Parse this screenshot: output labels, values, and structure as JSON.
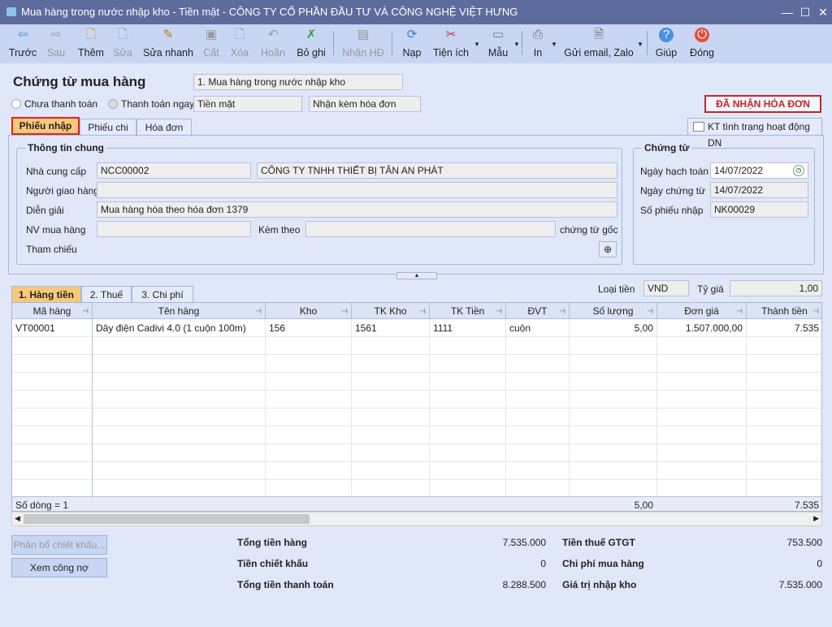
{
  "window": {
    "title": "Mua hàng trong nước nhập kho - Tiền mặt - CÔNG TY CỔ PHẦN ĐẦU TƯ VÀ CÔNG NGHỆ VIỆT HƯNG",
    "minimize": "—",
    "maximize": "☐",
    "close": "✕"
  },
  "toolbar": [
    {
      "label": "Trước",
      "icon": "arrow-left",
      "enabled": true
    },
    {
      "label": "Sau",
      "icon": "arrow-right",
      "enabled": false
    },
    {
      "label": "Thêm",
      "icon": "new-document",
      "enabled": true
    },
    {
      "label": "Sửa",
      "icon": "edit-document",
      "enabled": false
    },
    {
      "label": "Sửa nhanh",
      "icon": "quick-edit",
      "enabled": true
    },
    {
      "label": "Cất",
      "icon": "save",
      "enabled": false
    },
    {
      "label": "Xóa",
      "icon": "delete",
      "enabled": false
    },
    {
      "label": "Hoãn",
      "icon": "undo",
      "enabled": false
    },
    {
      "label": "Bỏ ghi",
      "icon": "unpost",
      "enabled": true
    },
    {
      "label": "Nhận HĐ",
      "icon": "receive-invoice",
      "enabled": false
    },
    {
      "label": "Nạp",
      "icon": "refresh",
      "enabled": true
    },
    {
      "label": "Tiện ích",
      "icon": "tools",
      "enabled": true
    },
    {
      "label": "Mẫu",
      "icon": "template",
      "enabled": true
    },
    {
      "label": "In",
      "icon": "printer",
      "enabled": true
    },
    {
      "label": "Gửi email, Zalo",
      "icon": "send",
      "enabled": true
    },
    {
      "label": "Giúp",
      "icon": "help",
      "enabled": true
    },
    {
      "label": "Đóng",
      "icon": "power",
      "enabled": true
    }
  ],
  "header": {
    "title": "Chứng từ mua hàng",
    "type": "1. Mua hàng trong nước nhập kho",
    "radio_unpaid": "Chưa thanh toán",
    "radio_paid": "Thanh toán ngay",
    "payment_method": "Tiền mặt",
    "invoice_option": "Nhận kèm hóa đơn",
    "status_badge": "ĐÃ NHẬN HÓA ĐƠN",
    "check_status_button": "KT tình trạng hoạt động DN"
  },
  "tabs": [
    "Phiếu nhập",
    "Phiếu chi",
    "Hóa đơn"
  ],
  "general": {
    "title": "Thông tin chung",
    "supplier_label": "Nhà cung cấp",
    "supplier_code": "NCC00002",
    "supplier_name": "CÔNG TY TNHH THIẾT BỊ TÂN AN PHÁT",
    "deliverer_label": "Người giao hàng",
    "deliverer": "",
    "description_label": "Diễn giải",
    "description": "Mua hàng hóa theo hóa đơn 1379",
    "staff_label": "NV mua hàng",
    "staff": "",
    "attach_label": "Kèm theo",
    "attach": "",
    "attach_suffix": "chứng từ gốc",
    "reference_label": "Tham chiếu"
  },
  "voucher": {
    "title": "Chứng từ",
    "posting_date_label": "Ngày hạch toán",
    "posting_date": "14/07/2022",
    "voucher_date_label": "Ngày chứng từ",
    "voucher_date": "14/07/2022",
    "number_label": "Số phiếu nhập",
    "number": "NK00029"
  },
  "detail_tabs": [
    "1. Hàng tiền",
    "2. Thuế",
    "3. Chi phí"
  ],
  "currency": {
    "label": "Loại tiền",
    "value": "VND",
    "rate_label": "Tỷ giá",
    "rate": "1,00"
  },
  "grid": {
    "columns": [
      "Mã hàng",
      "Tên hàng",
      "Kho",
      "TK Kho",
      "TK Tiền",
      "ĐVT",
      "Số lượng",
      "Đơn giá",
      "Thành tiền"
    ],
    "rows": [
      [
        "VT00001",
        "Dây điện Cadivi 4.0 (1 cuộn 100m)",
        "156",
        "1561",
        "1111",
        "cuộn",
        "5,00",
        "1.507.000,00",
        "7.535"
      ]
    ],
    "footer": {
      "row_count": "Số dòng = 1",
      "quantity": "5,00",
      "amount": "7.535"
    }
  },
  "buttons": {
    "allocate_discount": "Phân bổ chiết khấu...",
    "view_debt": "Xem công nợ"
  },
  "totals": {
    "goods_label": "Tổng tiền hàng",
    "goods": "7.535.000",
    "discount_label": "Tiền chiết khấu",
    "discount": "0",
    "payment_label": "Tổng tiền thanh toán",
    "payment": "8.288.500",
    "vat_label": "Tiền thuế GTGT",
    "vat": "753.500",
    "purchase_cost_label": "Chi phí mua hàng",
    "purchase_cost": "0",
    "stock_value_label": "Giá trị nhập kho",
    "stock_value": "7.535.000"
  }
}
